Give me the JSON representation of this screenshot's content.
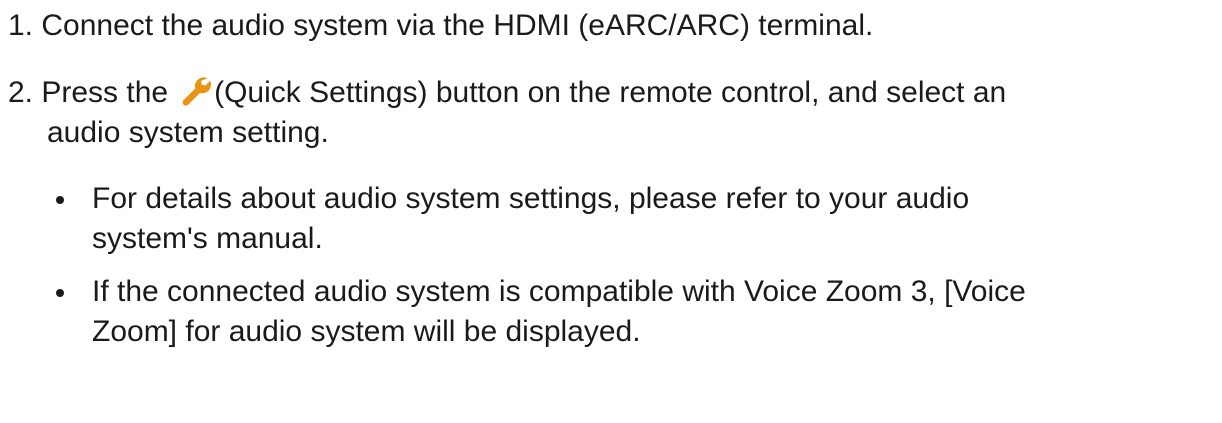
{
  "steps": [
    {
      "number": "1.",
      "text": "Connect the audio system via the HDMI (eARC/ARC) terminal."
    },
    {
      "number": "2.",
      "text_before_icon": "Press the",
      "icon": "wrench-icon",
      "text_after_icon": "(Quick Settings) button on the remote control, and select an",
      "text_continued": "audio system setting."
    }
  ],
  "bullets": [
    {
      "line1": "For details about audio system settings, please refer to your audio",
      "line2": "system's manual."
    },
    {
      "line1": "If the connected audio system is compatible with Voice Zoom 3, [Voice",
      "line2": "Zoom] for audio system will be displayed."
    }
  ]
}
